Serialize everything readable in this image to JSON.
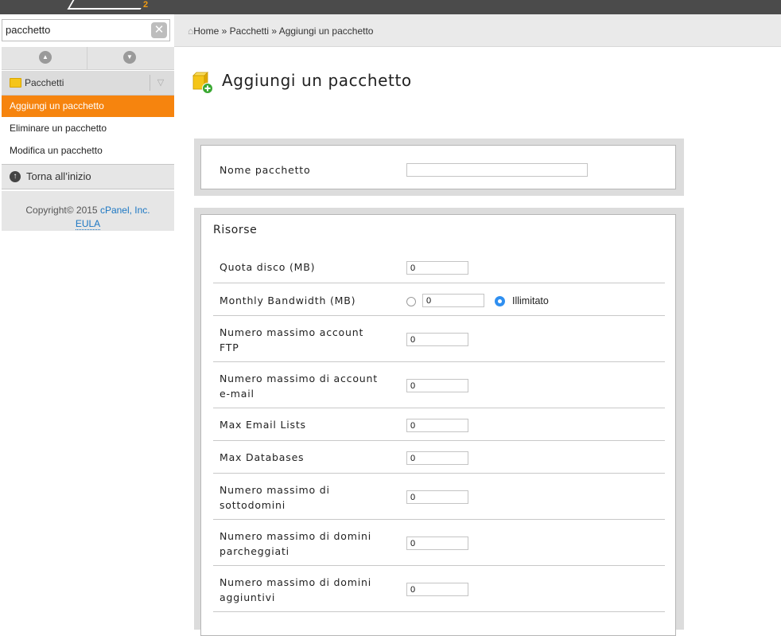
{
  "sidebar": {
    "search_value": "pacchetto",
    "clear_icon": "close-icon",
    "group_label": "Pacchetti",
    "items": [
      {
        "label": "Aggiungi un pacchetto",
        "active": true
      },
      {
        "label": "Eliminare un pacchetto",
        "active": false
      },
      {
        "label": "Modifica un pacchetto",
        "active": false
      }
    ],
    "back_label": "Torna all’inizio",
    "copyright_prefix": "Copyright© 2015",
    "copyright_company": "cPanel, Inc.",
    "eula": "EULA"
  },
  "breadcrumb": {
    "home": "Home",
    "sep": "»",
    "level1": "Pacchetti",
    "current": "Aggiungi un pacchetto"
  },
  "page": {
    "title": "Aggiungi un pacchetto"
  },
  "form": {
    "package_name_label": "Nome pacchetto",
    "package_name_value": "",
    "resources_title": "Risorse",
    "disk_quota_label": "Quota disco (MB)",
    "disk_quota_value": "0",
    "bandwidth_label": "Monthly Bandwidth (MB)",
    "bandwidth_value": "0",
    "bandwidth_unlimited_label": "Illimitato",
    "ftp_label_1": "Numero massimo account",
    "ftp_label_2": "FTP",
    "ftp_value": "0",
    "email_label_1": "Numero massimo di account",
    "email_label_2": "e-mail",
    "email_value": "0",
    "email_lists_label": "Max Email Lists",
    "email_lists_value": "0",
    "databases_label": "Max Databases",
    "databases_value": "0",
    "subdomains_label_1": "Numero massimo di",
    "subdomains_label_2": "sottodomini",
    "subdomains_value": "0",
    "parked_label_1": "Numero massimo di domini",
    "parked_label_2": "parcheggiati",
    "parked_value": "0",
    "addon_label_1": "Numero massimo di domini",
    "addon_label_2": "aggiuntivi",
    "addon_value": "0"
  },
  "colors": {
    "accent": "#f6840e",
    "link": "#1c77c3",
    "radio_selected": "#2f8ff0",
    "topbar": "#4b4b4b"
  }
}
